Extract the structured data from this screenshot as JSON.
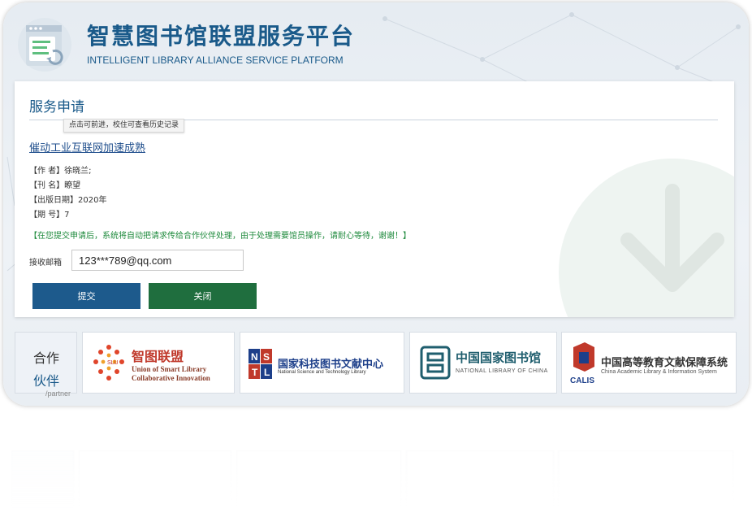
{
  "header": {
    "title": "智慧图书馆联盟服务平台",
    "subtitle": "INTELLIGENT LIBRARY ALLIANCE SERVICE PLATFORM",
    "logo_icon": "document-refresh-icon"
  },
  "form": {
    "section_title": "服务申请",
    "tooltip": "点击可前进，校住可查看历史记录",
    "article_title": "催动工业互联网加速成熟",
    "meta": {
      "author": "【作 者】徐晓兰;",
      "journal": "【刊 名】瞭望",
      "date": "【出版日期】2020年",
      "issue": "【期 号】7"
    },
    "notice": "【在您提交申请后，系统将自动把请求传给合作伙伴处理，由于处理需要馆员操作，请耐心等待，谢谢！】",
    "email_label": "接收邮箱",
    "email_value": "123***789@qq.com",
    "submit_label": "提交",
    "close_label": "关闭"
  },
  "partners": {
    "label_top": "合作",
    "label_mid": "伙伴",
    "label_en": "/partner",
    "items": [
      {
        "name_cn": "智图联盟",
        "name_en_1": "Union of Smart Library",
        "name_en_2": "Collaborative Innovation",
        "badge": "SLU"
      },
      {
        "name_cn": "国家科技图书文献中心",
        "name_en": "National Science and Technology Library",
        "badge": "NSTL"
      },
      {
        "name_cn": "中国国家图书馆",
        "name_en": "NATIONAL LIBRARY OF CHINA"
      },
      {
        "name_cn": "中国高等教育文献保障系统",
        "name_en": "China Academic Library & Information System",
        "badge": "CALIS"
      }
    ]
  },
  "colors": {
    "brand_blue": "#1a5a8a",
    "submit_bg": "#1d5a8c",
    "close_bg": "#1f6e3e",
    "notice_green": "#1e8a3c",
    "link_blue": "#1f4e8c"
  }
}
